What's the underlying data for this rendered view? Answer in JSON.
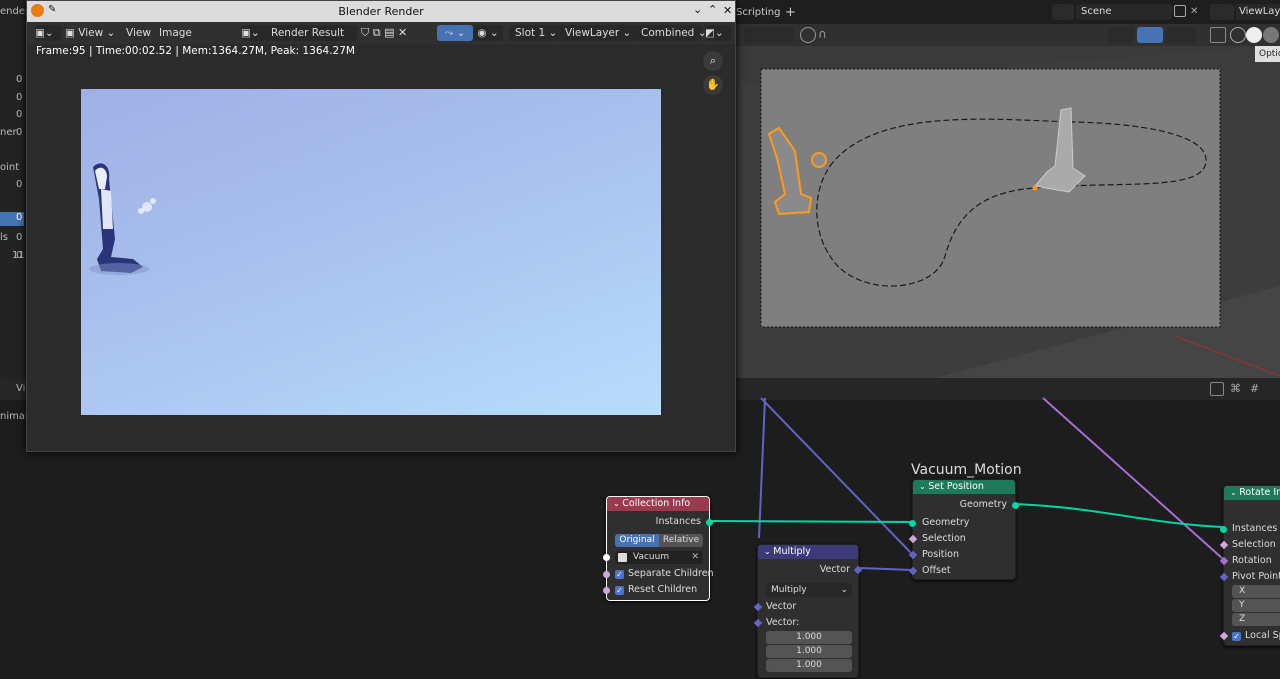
{
  "left_panel": {
    "labels": [
      "ender",
      "0",
      "0",
      "0",
      "ner",
      "0",
      "oint",
      "0",
      "0",
      "0",
      "ls",
      "0",
      "11",
      "Vi",
      "nimati"
    ]
  },
  "render_window": {
    "title": "Blender Render",
    "menu": {
      "view1": "View",
      "view2": "View",
      "image": "Image"
    },
    "image_name": "Render Result",
    "slot": "Slot 1",
    "view_layer": "ViewLayer",
    "pass": "Combined",
    "status": "Frame:95 | Time:00:02.52 | Mem:1364.27M, Peak: 1364.27M"
  },
  "top_header": {
    "workspace_tab": "Scripting",
    "add_tab": "+",
    "scene": "Scene",
    "view_layer": "ViewLaye",
    "options": "Optio"
  },
  "node_editor": {
    "frame_label": "Vacuum_Motion",
    "collection_info": {
      "title": "Collection Info",
      "out_instances": "Instances",
      "btn_original": "Original",
      "btn_relative": "Relative",
      "collection": "Vacuum",
      "separate_children": "Separate Children",
      "reset_children": "Reset Children"
    },
    "multiply": {
      "title": "Multiply",
      "out_vector": "Vector",
      "operation": "Multiply",
      "in_vector": "Vector",
      "in_vector2": "Vector:",
      "values": [
        "1.000",
        "1.000",
        "1.000"
      ]
    },
    "set_position": {
      "title": "Set Position",
      "out_geometry": "Geometry",
      "in_geometry": "Geometry",
      "in_selection": "Selection",
      "in_position": "Position",
      "in_offset": "Offset"
    },
    "rotate_instances": {
      "title": "Rotate Ins",
      "in_instances": "Instances",
      "in_selection": "Selection",
      "in_rotation": "Rotation",
      "in_pivot": "Pivot Point:",
      "x": "X",
      "y": "Y",
      "z": "Z",
      "local_space": "Local Spa"
    }
  },
  "colors": {
    "collection_header": "#9b3a4d",
    "multiply_header": "#3b3b7a",
    "set_position_header": "#1f7a5c",
    "geometry_link": "#00d6a3",
    "vector_link": "#6363c7",
    "rotation_link": "#a86fd1"
  }
}
